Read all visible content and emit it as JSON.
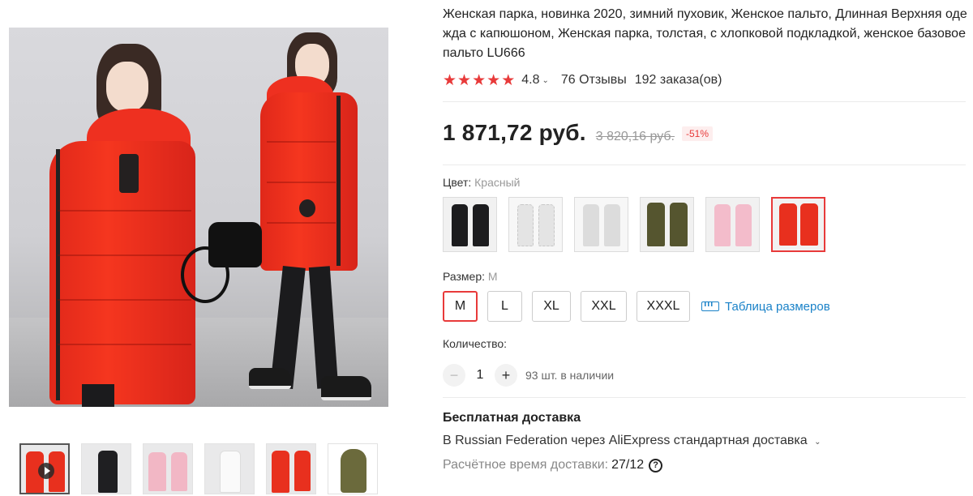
{
  "product": {
    "title": "Женская парка, новинка 2020, зимний пуховик, Женское пальто, Длинная Верхняя одежда с капюшоном, Женская парка, толстая, с хлопковой подкладкой, женское базовое пальто LU666",
    "rating": "4.8",
    "reviews": "76 Отзывы",
    "orders": "192 заказа(ов)",
    "stars_filled": 5
  },
  "price": {
    "current": "1 871,72 руб.",
    "old": "3 820,16 руб.",
    "discount": "-51%"
  },
  "color": {
    "label": "Цвет:",
    "selected": "Красный",
    "swatches": [
      "black",
      "white-grey",
      "light-grey",
      "army-green",
      "pink",
      "red"
    ],
    "selected_index": 5
  },
  "size": {
    "label": "Размер:",
    "selected": "M",
    "options": [
      "M",
      "L",
      "XL",
      "XXL",
      "XXXL"
    ],
    "chart_link": "Таблица размеров"
  },
  "quantity": {
    "label": "Количество:",
    "value": "1",
    "minus": "−",
    "plus": "+",
    "stock": "93 шт. в наличии"
  },
  "shipping": {
    "title": "Бесплатная доставка",
    "line": "В Russian Federation через AliExpress стандартная доставка",
    "eta_label": "Расчётное время доставки:",
    "eta_date": "27/12",
    "help": "?"
  },
  "colors": {
    "accent": "#e83a3a",
    "link": "#1a82c8",
    "coat_red": "#f5361f"
  },
  "icons": {
    "star": "★",
    "chevron": "⌄"
  }
}
